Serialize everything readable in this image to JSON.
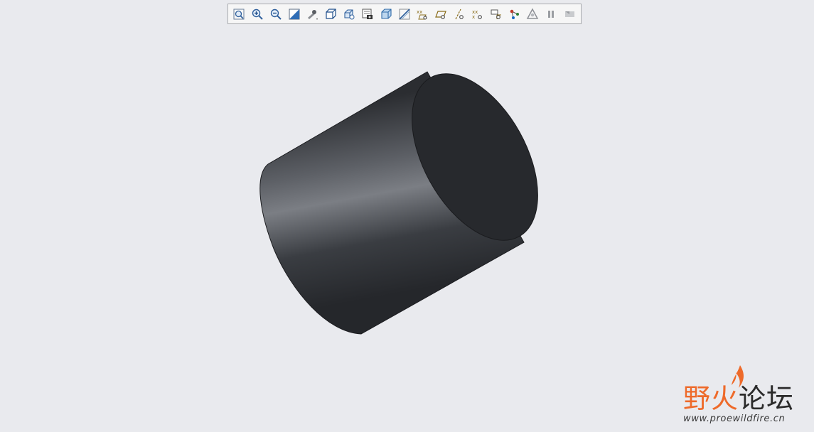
{
  "toolbar": {
    "items": [
      {
        "name": "refit-icon"
      },
      {
        "name": "zoom-in-icon"
      },
      {
        "name": "zoom-out-icon"
      },
      {
        "name": "repaint-icon"
      },
      {
        "name": "perspective-view-icon"
      },
      {
        "name": "display-style-icon"
      },
      {
        "name": "named-views-icon"
      },
      {
        "name": "saved-orientations-icon"
      },
      {
        "name": "view-manager-icon"
      },
      {
        "name": "section-icon"
      },
      {
        "name": "datum-display-icon"
      },
      {
        "name": "plane-display-icon"
      },
      {
        "name": "axis-display-icon"
      },
      {
        "name": "point-display-icon"
      },
      {
        "name": "csys-display-icon"
      },
      {
        "name": "annotation-display-icon"
      },
      {
        "name": "spin-center-icon"
      },
      {
        "name": "appearance-icon"
      },
      {
        "name": "pause-icon"
      },
      {
        "name": "regenerate-icon"
      }
    ]
  },
  "watermark": {
    "title_accent": "野火",
    "title_rest": "论坛",
    "url": "www.proewildfire.cn"
  },
  "colors": {
    "background": "#e9eaee",
    "model_dark": "#26282c",
    "model_highlight": "#7d8086",
    "accent": "#ee6a2a"
  }
}
